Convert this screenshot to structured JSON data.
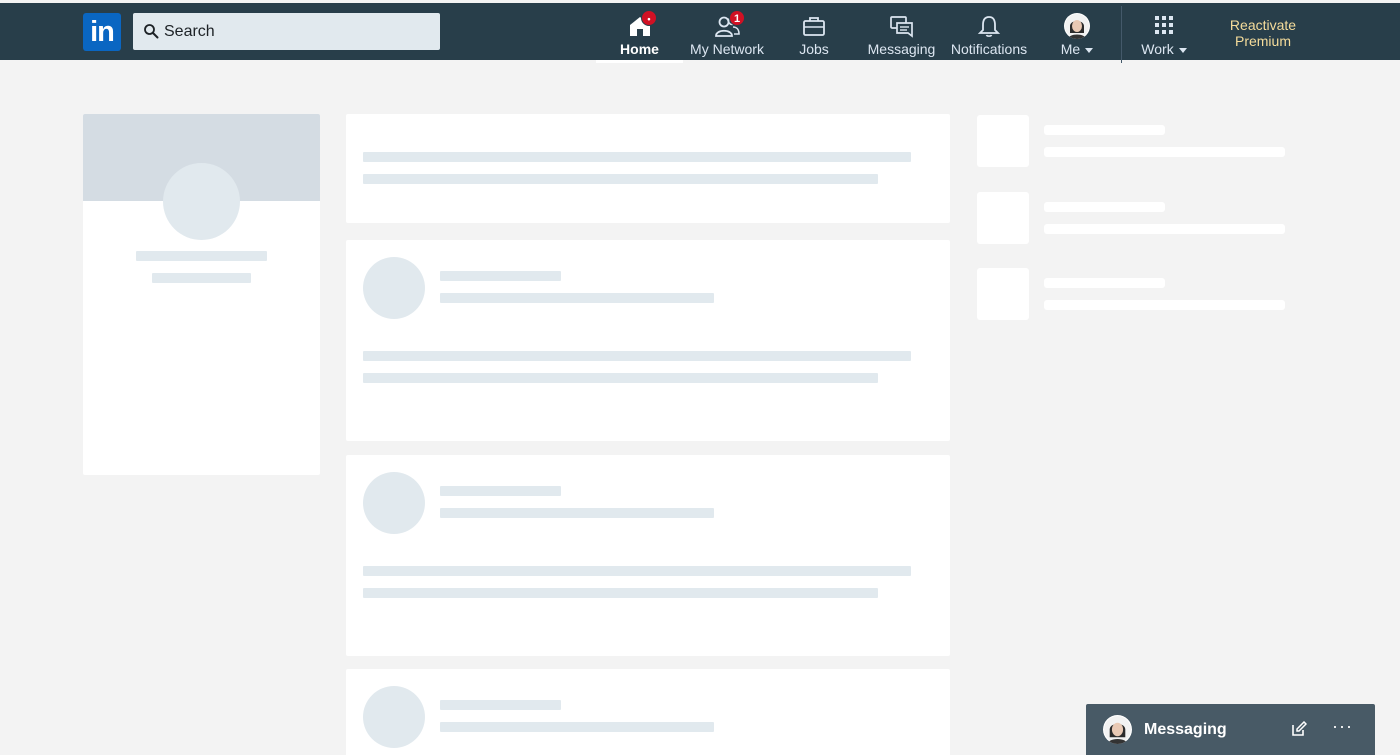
{
  "nav": {
    "logo": "in",
    "search_placeholder": "Search",
    "items": [
      {
        "label": "Home",
        "icon": "home-icon",
        "badge": "•"
      },
      {
        "label": "My Network",
        "icon": "network-icon",
        "badge": "1"
      },
      {
        "label": "Jobs",
        "icon": "briefcase-icon"
      },
      {
        "label": "Messaging",
        "icon": "messaging-icon"
      },
      {
        "label": "Notifications",
        "icon": "bell-icon"
      },
      {
        "label": "Me",
        "icon": "avatar"
      },
      {
        "label": "Work",
        "icon": "grid-icon"
      }
    ],
    "premium_line1": "Reactivate",
    "premium_line2": "Premium"
  },
  "messaging_bar": {
    "label": "Messaging",
    "compose_icon": "compose-icon",
    "more_icon": "more-icon",
    "more_text": "···"
  },
  "colors": {
    "nav_bg": "#283e4a",
    "page_bg": "#f3f3f3",
    "skeleton": "#e1e9ee",
    "badge": "#d11124",
    "premium": "#f5dc9b"
  }
}
